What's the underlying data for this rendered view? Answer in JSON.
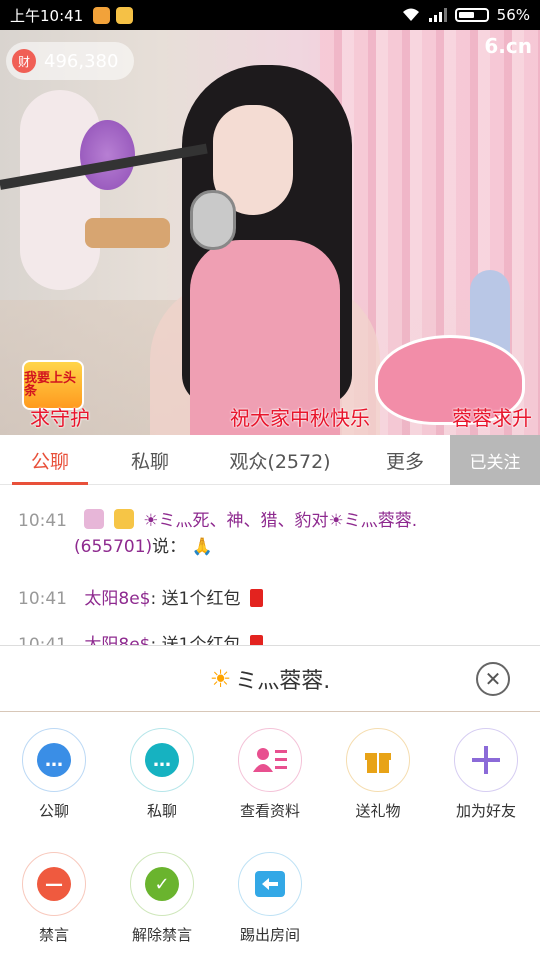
{
  "status_bar": {
    "time": "上午10:41",
    "battery": "56%",
    "battery_level": 0.56
  },
  "stream": {
    "coin_icon_text": "财",
    "coins": "496,380",
    "logo": "6.cn",
    "overlay_left": "求守护",
    "overlay_center": "祝大家中秋快乐",
    "overlay_right": "蓉蓉求升",
    "sticker_text": "我要上头条"
  },
  "tabs": {
    "public": "公聊",
    "private": "私聊",
    "audience": "观众(2572)",
    "more": "更多",
    "follow": "已关注"
  },
  "chat": [
    {
      "time": "10:41",
      "line1": "☀ミ灬死、神、猎、豹对☀ミ灬蓉蓉.",
      "line2_id": "(655701)",
      "line2_text": "说：",
      "line2_emoji": "🙏"
    },
    {
      "time": "10:41",
      "name": "太阳8e$",
      "text": ": 送1个红包"
    },
    {
      "time": "10:41",
      "name": "太阳8e$",
      "text": ": 送1个红包"
    }
  ],
  "sheet": {
    "title_icon": "☀",
    "title": "ミ灬蓉蓉.",
    "actions": [
      {
        "label": "公聊",
        "icon": "chat-bubbles-icon",
        "color": "#3a8ee6"
      },
      {
        "label": "私聊",
        "icon": "message-icon",
        "color": "#16b2c1"
      },
      {
        "label": "查看资料",
        "icon": "profile-card-icon",
        "color": "#e8508f"
      },
      {
        "label": "送礼物",
        "icon": "gift-icon",
        "color": "#e8a317"
      },
      {
        "label": "加为好友",
        "icon": "plus-icon",
        "color": "#8b6ad8"
      },
      {
        "label": "禁言",
        "icon": "mute-icon",
        "color": "#ef5a3f"
      },
      {
        "label": "解除禁言",
        "icon": "unmute-check-icon",
        "color": "#6ab42e"
      },
      {
        "label": "踢出房间",
        "icon": "kick-out-icon",
        "color": "#33a8e6"
      }
    ]
  }
}
